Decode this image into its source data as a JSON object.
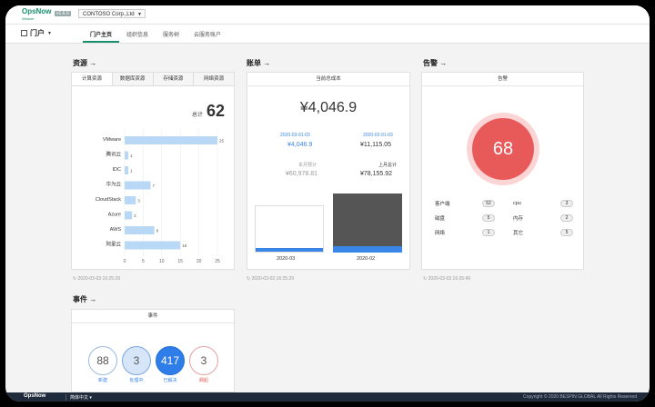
{
  "header": {
    "logo": "OpsNow",
    "logo_sub": "Weaver",
    "version": "v1.6.0",
    "company": "CONTOSO Corp.,Ltd"
  },
  "nav": {
    "portal": "门户",
    "tabs": [
      "门户主页",
      "组织信息",
      "服务树",
      "云服务账户"
    ]
  },
  "resources": {
    "title": "资源 →",
    "tabs": [
      "计算资源",
      "数据库资源",
      "存储资源",
      "网络资源"
    ],
    "total_label": "总计",
    "total": "62",
    "timestamp": "2020-03-03 16:25:29"
  },
  "chart_data": {
    "type": "bar",
    "orientation": "horizontal",
    "categories": [
      "VMware",
      "腾讯云",
      "IDC",
      "华为云",
      "CloudStack",
      "Azure",
      "AWS",
      "阿里云"
    ],
    "values": [
      25,
      1,
      1,
      7,
      3,
      2,
      8,
      15
    ],
    "xlim": [
      0,
      25
    ],
    "xticks": [
      0,
      5,
      10,
      15,
      20,
      25
    ],
    "color": "#b8d8f5"
  },
  "billing": {
    "title": "账单 →",
    "card_title": "当前总成本",
    "total": "¥4,046.9",
    "left_date": "2020-03-01-03",
    "left_amount": "¥4,046.9",
    "right_date": "2020-02-01-03",
    "right_amount": "¥11,115.05",
    "forecast_label": "本月预计",
    "forecast": "¥60,978.81",
    "last_label": "上月总计",
    "last": "¥78,155.92",
    "bar_labels": [
      "2020-03",
      "2020-02"
    ],
    "timestamp": "2020-03-03 16:25:29"
  },
  "alerts": {
    "title": "告警 →",
    "card_title": "告警",
    "count": "68",
    "items": [
      {
        "label": "客户端",
        "value": "52"
      },
      {
        "label": "cpu",
        "value": "3"
      },
      {
        "label": "磁盘",
        "value": "5"
      },
      {
        "label": "内存",
        "value": "2"
      },
      {
        "label": "网络",
        "value": "1"
      },
      {
        "label": "其它",
        "value": "5"
      }
    ],
    "timestamp": "2020-03-03 16:25:49"
  },
  "events": {
    "title": "事件 →",
    "card_title": "事件",
    "items": [
      {
        "value": "88",
        "label": "新建"
      },
      {
        "value": "3",
        "label": "处理中"
      },
      {
        "value": "417",
        "label": "已解决"
      },
      {
        "value": "3",
        "label": "搁起"
      }
    ]
  },
  "footer": {
    "brand": "OpsNow",
    "lang": "简体中文",
    "copyright": "Copyright © 2020 BESPIN GLOBAL All Rights Reserved"
  },
  "colors": {
    "accent": "#1a8f6c",
    "alert": "#e85a5a",
    "bar": "#b8d8f5",
    "blue": "#3a86e8"
  }
}
